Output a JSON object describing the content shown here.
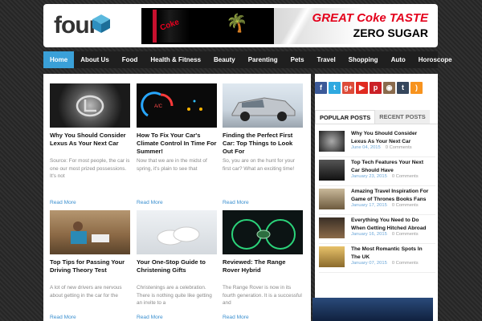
{
  "logo": {
    "text": "four"
  },
  "banner": {
    "can_text": "Coke",
    "headline": "GREAT Coke TASTE",
    "subline": "ZERO SUGAR"
  },
  "nav": {
    "items": [
      {
        "label": "Home",
        "active": true
      },
      {
        "label": "About Us"
      },
      {
        "label": "Food"
      },
      {
        "label": "Health & Fitness"
      },
      {
        "label": "Beauty"
      },
      {
        "label": "Parenting"
      },
      {
        "label": "Pets"
      },
      {
        "label": "Travel"
      },
      {
        "label": "Shopping"
      },
      {
        "label": "Auto"
      },
      {
        "label": "Horoscope"
      }
    ]
  },
  "posts": [
    {
      "title": "Why You Should Consider Lexus As Your Next Car",
      "excerpt": "Source: For most people, the car is one our most prized possessions. It's not",
      "more": "Read More"
    },
    {
      "title": "How To Fix Your Car's Climate Control In Time For Summer!",
      "excerpt": "Now that we are in the midst of spring, it's plain to see that",
      "more": "Read More"
    },
    {
      "title": "Finding the Perfect First Car: Top Things to Look Out For",
      "excerpt": "So, you are on the hunt for your first car? What an exciting time!",
      "more": "Read More"
    },
    {
      "title": "Top Tips for Passing Your Driving Theory Test",
      "excerpt": "A lot of new drivers are nervous about getting in the car for the",
      "more": "Read More"
    },
    {
      "title": "Your One-Stop Guide to Christening Gifts",
      "excerpt": "Christenings are a celebration. There is nothing quite like getting an invite to a",
      "more": "Read More"
    },
    {
      "title": "Reviewed: The Range Rover Hybrid",
      "excerpt": "The Range Rover is now in its fourth generation. It is a successful and",
      "more": "Read More"
    }
  ],
  "sidebar": {
    "social": [
      {
        "icon": "facebook-icon",
        "glyph": "f",
        "color": "#3b5998"
      },
      {
        "icon": "twitter-icon",
        "glyph": "t",
        "color": "#2fa9e0"
      },
      {
        "icon": "google-plus-icon",
        "glyph": "g+",
        "color": "#dd4b39"
      },
      {
        "icon": "youtube-icon",
        "glyph": "▶",
        "color": "#e02a20"
      },
      {
        "icon": "pinterest-icon",
        "glyph": "p",
        "color": "#cb2027"
      },
      {
        "icon": "instagram-icon",
        "glyph": "◉",
        "color": "#8a6b4d"
      },
      {
        "icon": "tumblr-icon",
        "glyph": "t",
        "color": "#35465c"
      },
      {
        "icon": "rss-icon",
        "glyph": ")",
        "color": "#f7931e"
      }
    ],
    "tabs": [
      {
        "label": "POPULAR POSTS",
        "active": true
      },
      {
        "label": "RECENT POSTS",
        "active": false
      }
    ],
    "popular": [
      {
        "title": "Why You Should Consider Lexus As Your Next Car",
        "date": "June 04, 2015",
        "comments": "0 Comments"
      },
      {
        "title": "Top Tech Features Your Next Car Should Have",
        "date": "January 23, 2015",
        "comments": "0 Comments"
      },
      {
        "title": "Amazing Travel Inspiration For Game of Thrones Books Fans",
        "date": "January 17, 2015",
        "comments": "0 Comments"
      },
      {
        "title": "Everything You Need to Do When Getting Hitched Abroad",
        "date": "January 16, 2015",
        "comments": "0 Comments"
      },
      {
        "title": "The Most Romantic Spots In The UK",
        "date": "January 07, 2015",
        "comments": "0 Comments"
      }
    ]
  }
}
